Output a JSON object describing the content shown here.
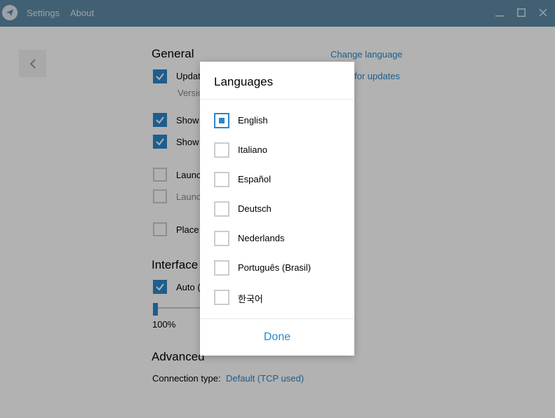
{
  "titlebar": {
    "menu": [
      "Settings",
      "About"
    ],
    "window_buttons": [
      "minimize-icon",
      "maximize-icon",
      "close-icon"
    ]
  },
  "settings": {
    "general_title": "General",
    "change_language": "Change language",
    "check_updates": "for updates",
    "items": {
      "update": "Updat",
      "version": "Versio",
      "show1": "Show",
      "show2": "Show",
      "launch1": "Launc",
      "launch2": "Launc",
      "place": "Place"
    },
    "interface_title": "Interface",
    "auto": "Auto (",
    "scale_value": "100%",
    "advanced_title": "Advanced",
    "connection_label": "Connection type:",
    "connection_value": "Default (TCP used)"
  },
  "dialog": {
    "title": "Languages",
    "languages": [
      "English",
      "Italiano",
      "Español",
      "Deutsch",
      "Nederlands",
      "Português (Brasil)",
      "한국어"
    ],
    "selected": "English",
    "done_label": "Done"
  },
  "colors": {
    "accent": "#2b87c9",
    "titlebar": "#5e8aa6"
  }
}
